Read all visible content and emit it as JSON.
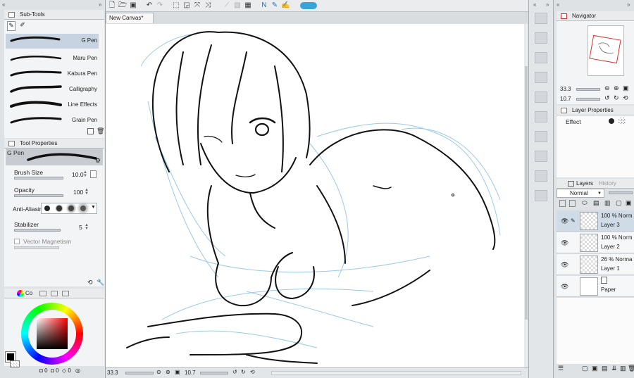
{
  "subtools": {
    "title": "Sub-Tools",
    "brushes": [
      {
        "label": "G Pen",
        "selected": true
      },
      {
        "label": "Maru Pen",
        "selected": false
      },
      {
        "label": "Kabura Pen",
        "selected": false
      },
      {
        "label": "Calligraphy",
        "selected": false
      },
      {
        "label": "Line Effects",
        "selected": false
      },
      {
        "label": "Grain Pen",
        "selected": false
      }
    ]
  },
  "tool_properties": {
    "title": "Tool Properties",
    "tool_name": "G Pen",
    "brush_size_label": "Brush Size",
    "brush_size_value": "10.0",
    "opacity_label": "Opacity",
    "opacity_value": "100",
    "antialias_label": "Anti-Aliasir",
    "stabilizer_label": "Stabilizer",
    "stabilizer_value": "5",
    "vector_magnetism_label": "Vector Magnetism"
  },
  "color_panel": {
    "tab_label": "Co",
    "values": [
      "0",
      "0",
      "0"
    ]
  },
  "canvas": {
    "tab_label": "New Canvas*",
    "tab_close": "●"
  },
  "status_bar": {
    "zoom": "33.3",
    "angle": "10.7"
  },
  "navigator": {
    "title": "Navigator",
    "zoom": "33.3",
    "angle": "10.7"
  },
  "layer_properties": {
    "title": "Layer Properties",
    "effect_label": "Effect"
  },
  "layers_panel": {
    "tab_layers": "Layers",
    "tab_history": "History",
    "blend_mode": "Normal",
    "layers": [
      {
        "opacity": "100 %",
        "mode": "Norm",
        "name": "Layer 3",
        "selected": true
      },
      {
        "opacity": "100 %",
        "mode": "Norm",
        "name": "Layer 2",
        "selected": false
      },
      {
        "opacity": "26 %",
        "mode": "Norma",
        "name": "Layer 1",
        "selected": false
      },
      {
        "opacity": "",
        "mode": "",
        "name": "Paper",
        "selected": false
      }
    ]
  },
  "colors": {
    "accent_blue": "#3aa3d8",
    "selection_bg": "#c7d3e0",
    "sketch_blue": "#9cc9e8",
    "navigator_frame": "#e03030"
  }
}
